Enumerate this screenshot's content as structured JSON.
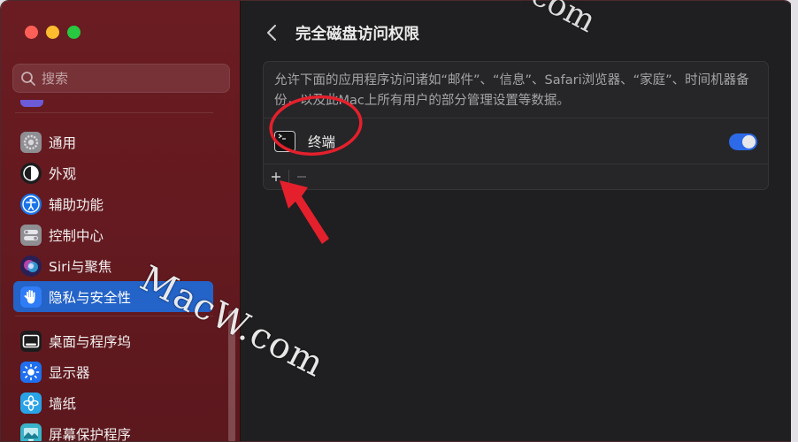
{
  "search": {
    "placeholder": "搜索"
  },
  "sidebar": {
    "items": [
      {
        "label": "通用",
        "icon": "gear-icon",
        "color": "#8e8e93"
      },
      {
        "label": "外观",
        "icon": "appearance-icon",
        "color": "#1c1c1e"
      },
      {
        "label": "辅助功能",
        "icon": "accessibility-icon",
        "color": "#1a73e8"
      },
      {
        "label": "控制中心",
        "icon": "control-center-icon",
        "color": "#8e8e93"
      },
      {
        "label": "Siri与聚焦",
        "icon": "siri-icon",
        "color": "#6b3fd6"
      },
      {
        "label": "隐私与安全性",
        "icon": "hand-icon",
        "color": "#2f7cf6",
        "active": true
      },
      {
        "label": "桌面与程序坞",
        "icon": "dock-icon",
        "color": "#1c1c1e"
      },
      {
        "label": "显示器",
        "icon": "display-icon",
        "color": "#1f6ff0"
      },
      {
        "label": "墙纸",
        "icon": "wallpaper-icon",
        "color": "#29a3e8"
      },
      {
        "label": "屏幕保护程序",
        "icon": "screensaver-icon",
        "color": "#39b3c9"
      }
    ]
  },
  "main": {
    "title": "完全磁盘访问权限",
    "description": "允许下面的应用程序访问诸如“邮件”、“信息”、Safari浏览器、“家庭”、时间机器备份，以及此Mac上所有用户的部分管理设置等数据。",
    "apps": [
      {
        "name": "终端",
        "icon": "terminal-icon",
        "enabled": true
      }
    ],
    "add_label": "+",
    "remove_label": "−"
  },
  "watermark": {
    "text": "MacW.com",
    "top_text": ".com"
  },
  "colors": {
    "accent": "#2463c7",
    "toggle_on": "#2d6ae8",
    "annotation": "#e4202c"
  }
}
